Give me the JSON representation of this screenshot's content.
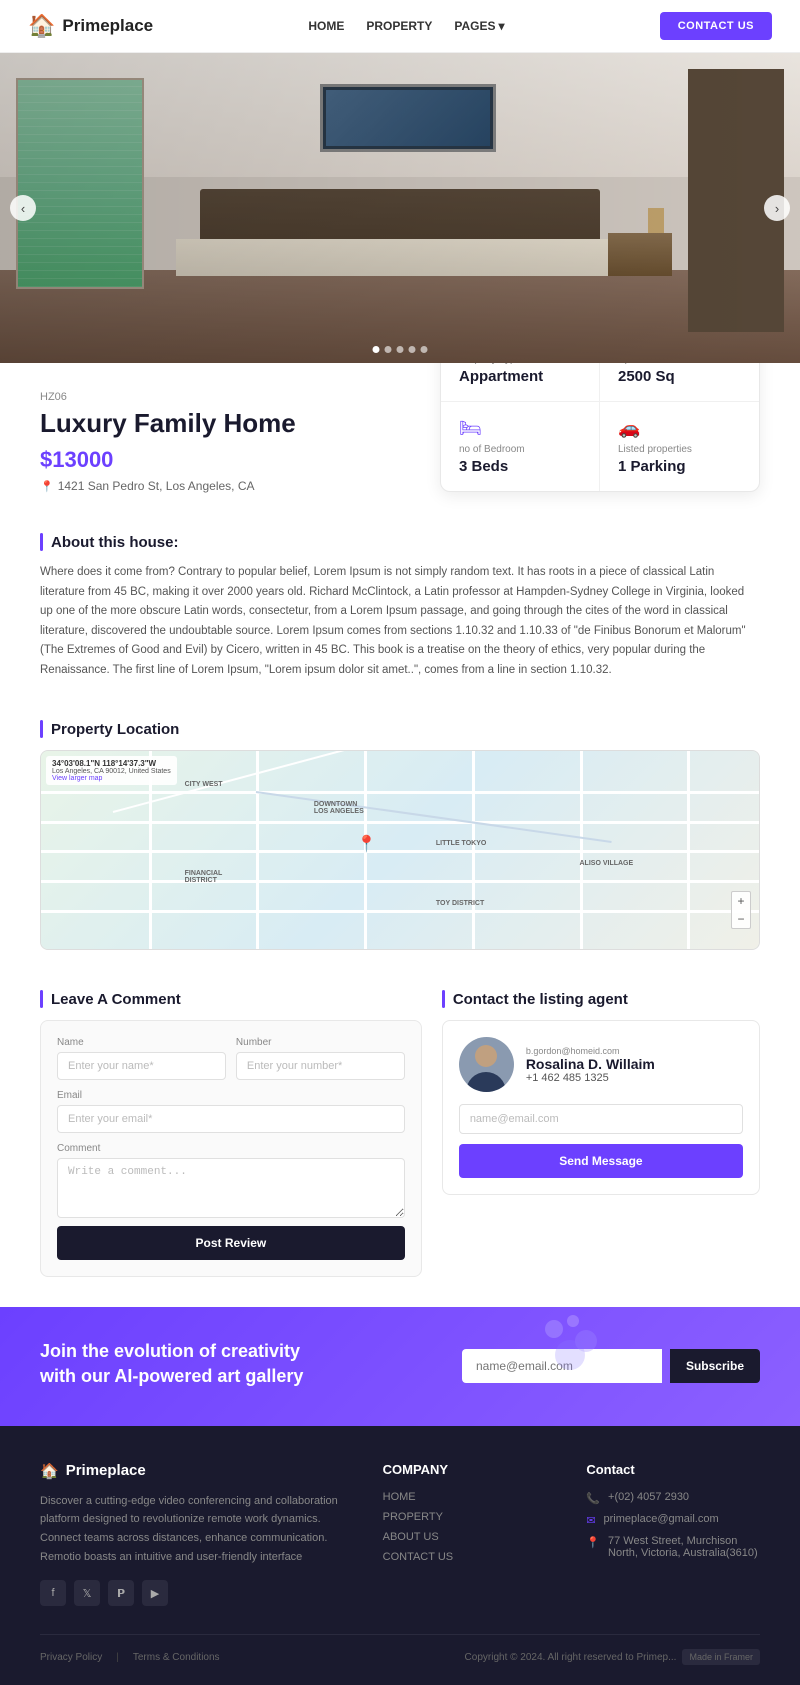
{
  "brand": {
    "name": "Primeplace",
    "logo_icon": "🏠"
  },
  "navbar": {
    "links": [
      "HOME",
      "PROPERTY",
      "PAGES"
    ],
    "cta": "CONTACT US"
  },
  "hero": {
    "dots": 5,
    "active_dot": 1
  },
  "property": {
    "code": "HZ06",
    "title": "Luxury Family Home",
    "price": "$13000",
    "address": "1421 San Pedro St, Los Angeles, CA",
    "stats": [
      {
        "icon": "🏢",
        "label": "Property Type",
        "value": "Appartment"
      },
      {
        "icon": "📐",
        "label": "Spacious life",
        "value": "2500 Sq"
      },
      {
        "icon": "🛏",
        "label": "no of Bedroom",
        "value": "3 Beds"
      },
      {
        "icon": "🚗",
        "label": "Listed properties",
        "value": "1 Parking"
      }
    ]
  },
  "about": {
    "title": "About this house:",
    "text": "Where does it come from? Contrary to popular belief, Lorem Ipsum is not simply random text. It has roots in a piece of classical Latin literature from 45 BC, making it over 2000 years old. Richard McClintock, a Latin professor at Hampden-Sydney College in Virginia, looked up one of the more obscure Latin words, consectetur, from a Lorem Ipsum passage, and going through the cites of the word in classical literature, discovered the undoubtable source. Lorem Ipsum comes from sections 1.10.32 and 1.10.33 of \"de Finibus Bonorum et Malorum\" (The Extremes of Good and Evil) by Cicero, written in 45 BC. This book is a treatise on the theory of ethics, very popular during the Renaissance. The first line of Lorem Ipsum, \"Lorem ipsum dolor sit amet..\", comes from a line in section 1.10.32."
  },
  "location": {
    "title": "Property Location",
    "coords": "34°03'08.1\"N 118°14'37.3\"W",
    "address_map": "Los Angeles, CA 90012, United States",
    "view_link": "View larger map"
  },
  "comment": {
    "title": "Leave A Comment",
    "name_label": "Name",
    "name_placeholder": "Enter your name*",
    "number_label": "Number",
    "number_placeholder": "Enter your number*",
    "email_label": "Email",
    "email_placeholder": "Enter your email*",
    "comment_label": "Comment",
    "comment_placeholder": "Write a comment...",
    "submit_label": "Post Review"
  },
  "agent": {
    "title": "Contact the listing agent",
    "email_small": "b.gordon@homeid.com",
    "name": "Rosalina D. Willaim",
    "phone": "+1 462 485 1325",
    "email_placeholder": "name@email.com",
    "send_label": "Send Message"
  },
  "cta": {
    "title_line1": "Join the evolution of creativity",
    "title_line2": "with our AI-powered art gallery",
    "email_placeholder": "name@email.com",
    "subscribe_label": "Subscribe"
  },
  "footer": {
    "brand": "Primeplace",
    "description": "Discover a cutting-edge video conferencing and collaboration platform designed to revolutionize remote work dynamics. Connect teams across distances, enhance communication. Remotio boasts an intuitive and user-friendly interface",
    "company_title": "COMPANY",
    "company_links": [
      "HOME",
      "PROPERTY",
      "ABOUT US",
      "CONTACT US"
    ],
    "contact_title": "Contact",
    "contact_phone": "+(02) 4057 2930",
    "contact_email": "primeplace@gmail.com",
    "contact_address": "77 West Street, Murchison North, Victoria, Australia(3610)",
    "bottom_links": [
      "Privacy Policy",
      "Terms & Conditions"
    ],
    "copyright": "Copyright © 2024. All right reserved to Primep...",
    "made_in": "Made in Framer"
  }
}
